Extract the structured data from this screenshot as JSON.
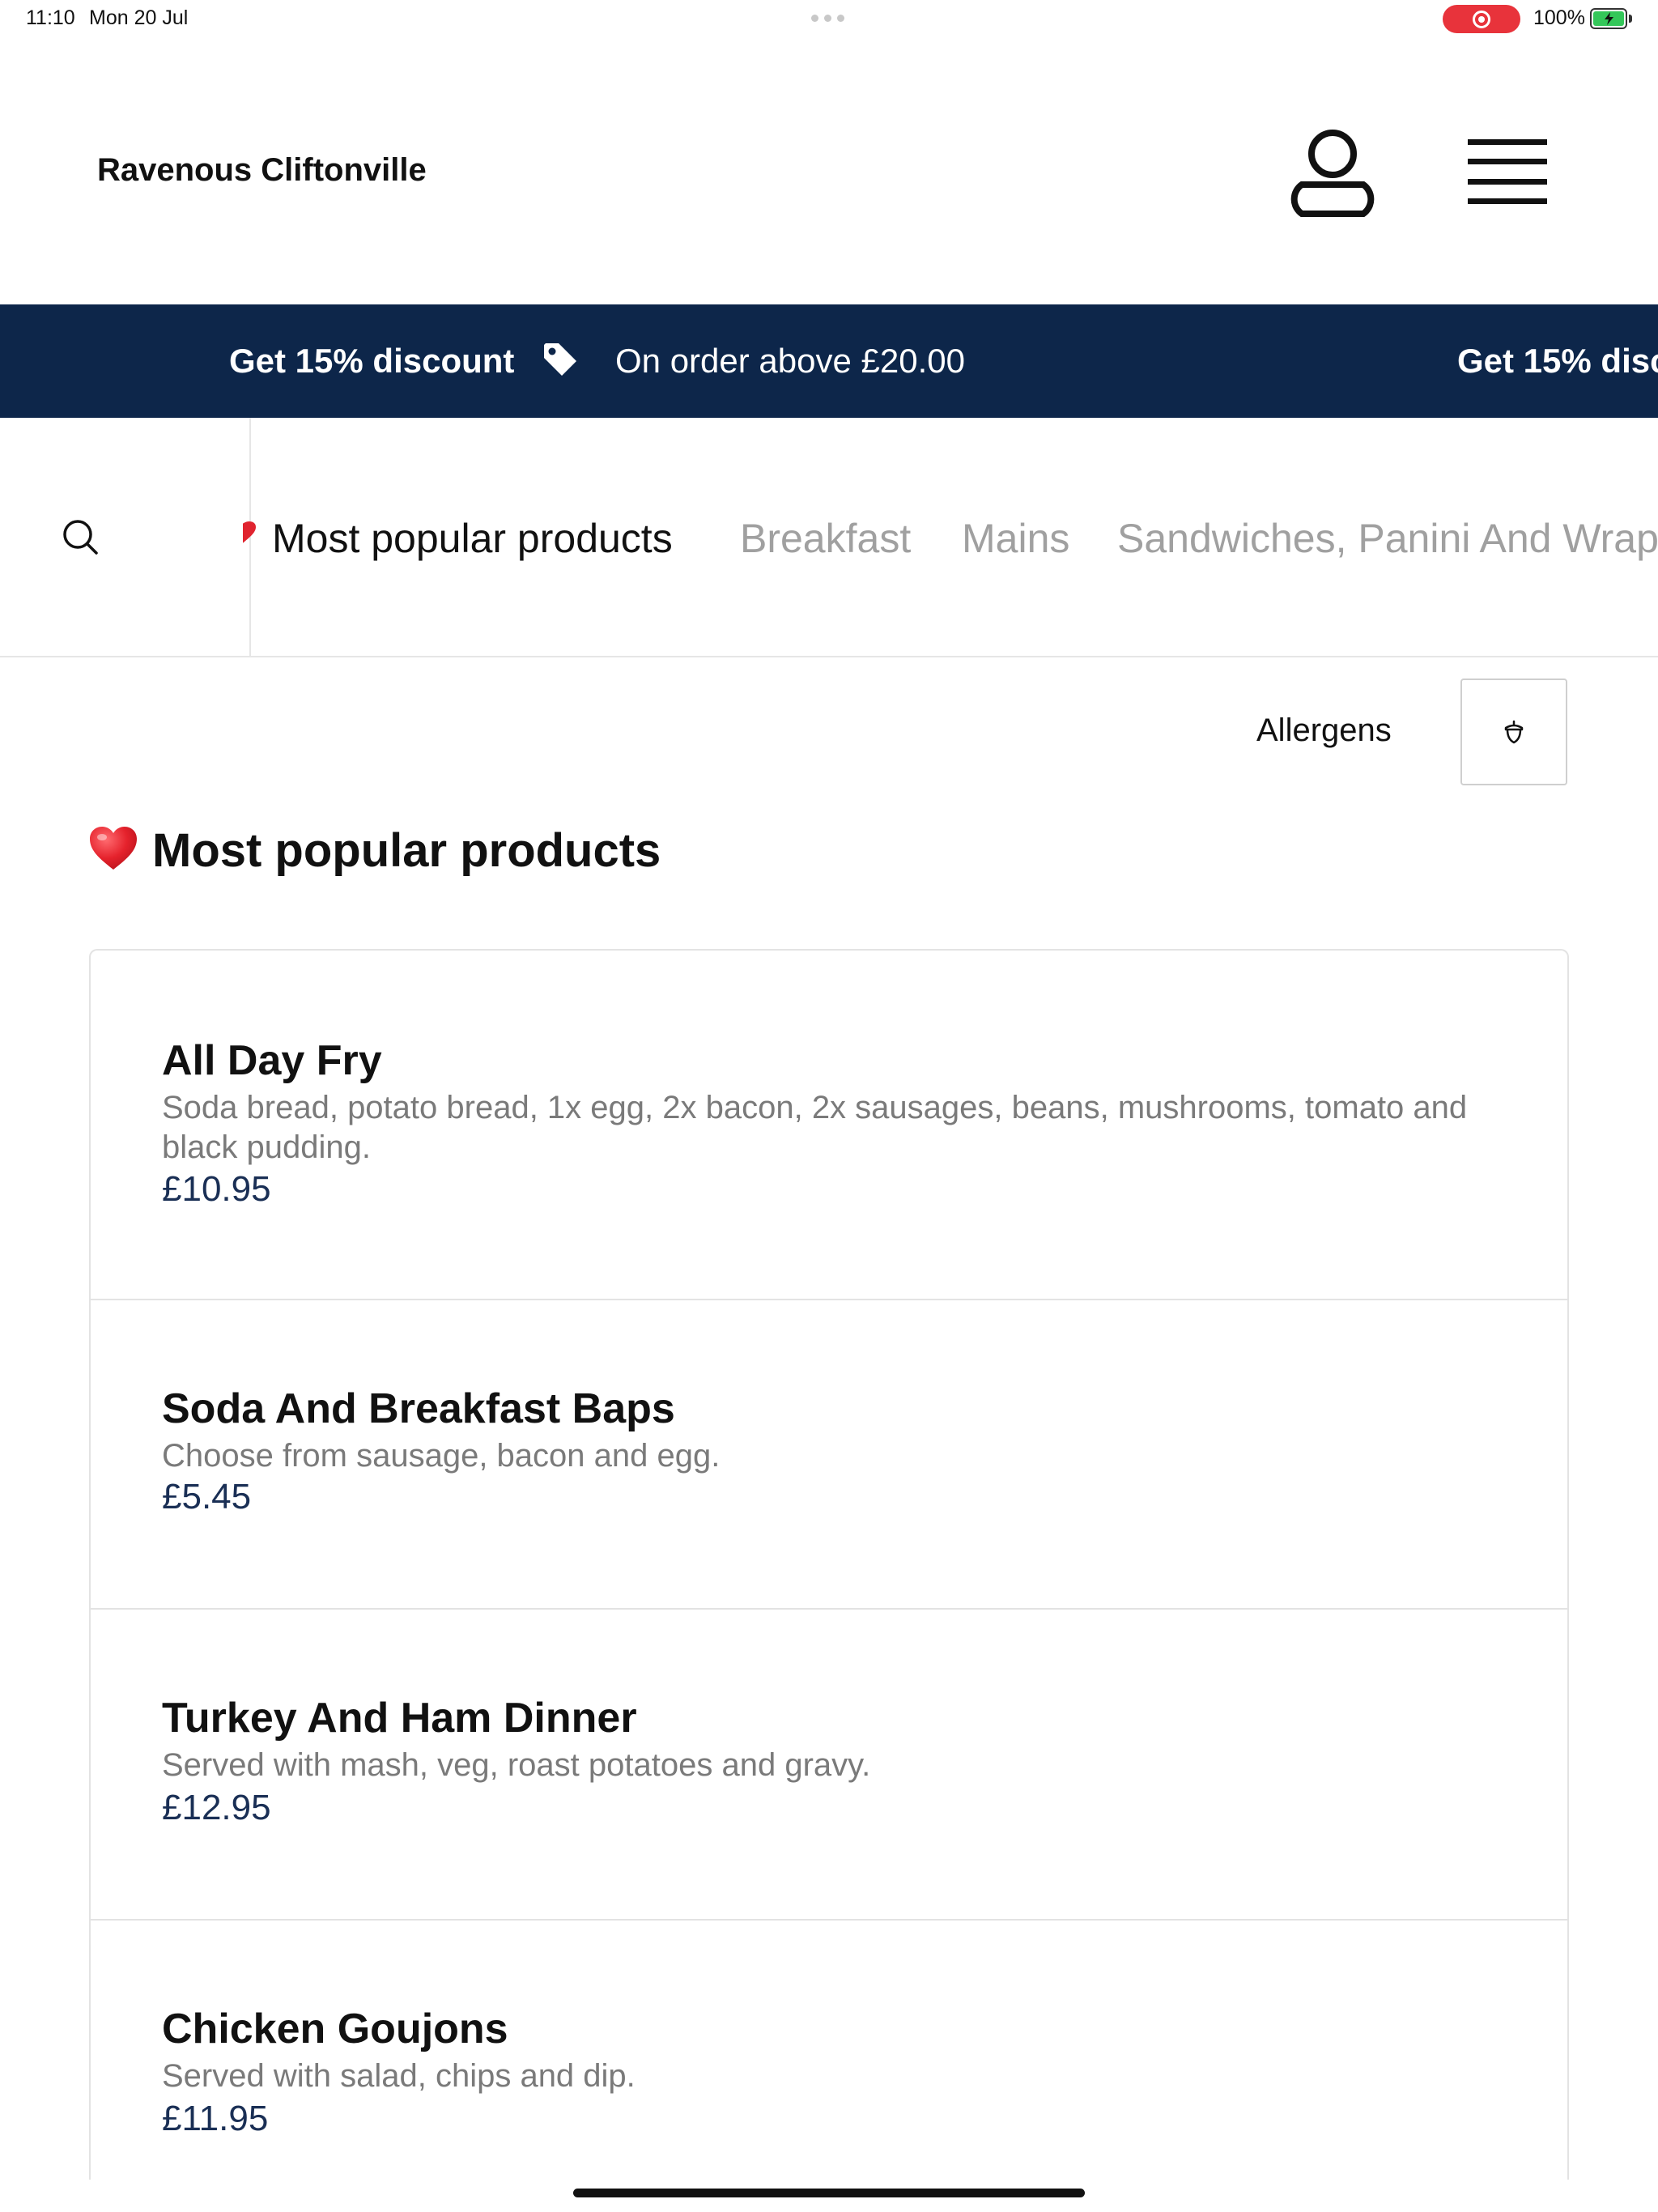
{
  "status_bar": {
    "time": "11:10",
    "date": "Mon 20 Jul",
    "battery": "100%",
    "record_color": "#e8333b",
    "battery_color": "#34c759"
  },
  "header": {
    "store_name": "Ravenous Cliftonville",
    "account_icon": "user-icon",
    "menu_icon": "hamburger-menu-icon"
  },
  "promo": {
    "title": "Get 15% discount",
    "subtitle": "On order above £20.00",
    "title_repeat": "Get 15% disc",
    "icon": "tag-icon",
    "background": "#0d264a"
  },
  "category_nav": {
    "search_icon": "search-icon",
    "tabs": [
      {
        "label": "Most popular products",
        "active": true
      },
      {
        "label": "Breakfast",
        "active": false
      },
      {
        "label": "Mains",
        "active": false
      },
      {
        "label": "Sandwiches, Panini And Wrap",
        "active": false
      }
    ]
  },
  "allergens": {
    "label": "Allergens",
    "icon": "acorn-icon"
  },
  "section": {
    "emoji": "heart-icon",
    "title": "Most popular products"
  },
  "products": [
    {
      "name": "All Day Fry",
      "description": "Soda bread, potato bread, 1x egg, 2x bacon, 2x sausages, beans, mushrooms, tomato and black pudding.",
      "price": "£10.95"
    },
    {
      "name": "Soda And Breakfast Baps",
      "description": "Choose from sausage, bacon and egg.",
      "price": "£5.45"
    },
    {
      "name": "Turkey And Ham Dinner",
      "description": "Served with mash, veg, roast potatoes and gravy.",
      "price": "£12.95"
    },
    {
      "name": "Chicken Goujons",
      "description": "Served with salad, chips and dip.",
      "price": "£11.95"
    }
  ],
  "colors": {
    "accent": "#0d264a",
    "price": "#1a2f55",
    "muted_text": "#7a7a7a"
  }
}
